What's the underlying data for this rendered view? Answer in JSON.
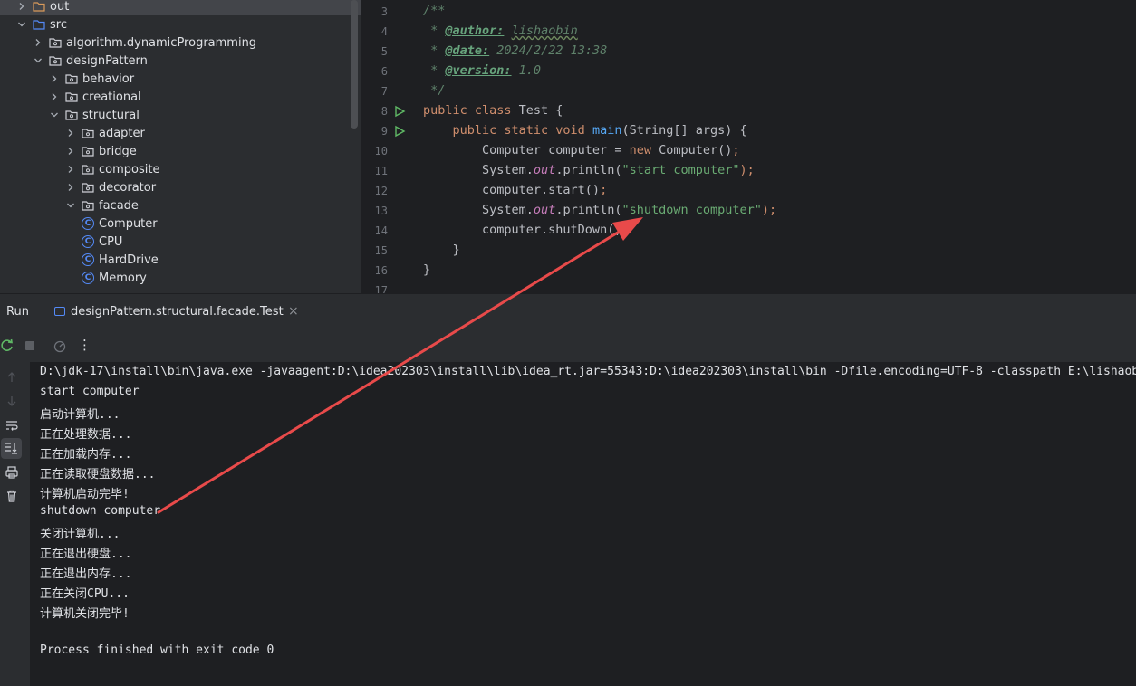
{
  "project_tree": [
    {
      "label": "out",
      "type": "folder",
      "state": "collapsed",
      "level": 0,
      "selected": true
    },
    {
      "label": "src",
      "type": "folder",
      "state": "expanded",
      "level": 0
    },
    {
      "label": "algorithm.dynamicProgramming",
      "type": "package",
      "state": "collapsed",
      "level": 1
    },
    {
      "label": "designPattern",
      "type": "package",
      "state": "expanded",
      "level": 1
    },
    {
      "label": "behavior",
      "type": "package",
      "state": "collapsed",
      "level": 2
    },
    {
      "label": "creational",
      "type": "package",
      "state": "collapsed",
      "level": 2
    },
    {
      "label": "structural",
      "type": "package",
      "state": "expanded",
      "level": 2
    },
    {
      "label": "adapter",
      "type": "package",
      "state": "collapsed",
      "level": 3
    },
    {
      "label": "bridge",
      "type": "package",
      "state": "collapsed",
      "level": 3
    },
    {
      "label": "composite",
      "type": "package",
      "state": "collapsed",
      "level": 3
    },
    {
      "label": "decorator",
      "type": "package",
      "state": "collapsed",
      "level": 3
    },
    {
      "label": "facade",
      "type": "package",
      "state": "expanded",
      "level": 3
    },
    {
      "label": "Computer",
      "type": "class",
      "level": 4
    },
    {
      "label": "CPU",
      "type": "class",
      "level": 4
    },
    {
      "label": "HardDrive",
      "type": "class",
      "level": 4
    },
    {
      "label": "Memory",
      "type": "class",
      "level": 4
    }
  ],
  "editor": {
    "line_numbers": [
      "3",
      "4",
      "5",
      "6",
      "7",
      "8",
      "9",
      "10",
      "11",
      "12",
      "13",
      "14",
      "15",
      "16",
      "17"
    ],
    "lines": {
      "l3": "/**",
      "l4_pre": " * ",
      "l4_tag": "@author:",
      "l4_val": "lishaobin",
      "l5_pre": " * ",
      "l5_tag": "@date:",
      "l5_val": " 2024/2/22 13:38",
      "l6_pre": " * ",
      "l6_tag": "@version:",
      "l6_val": " 1.0",
      "l7": " */",
      "l8_kw": "public class ",
      "l8_id": "Test {",
      "l9_kw": "    public static void ",
      "l9_fn": "main",
      "l9_id": "(String[] args) {",
      "l10_id1": "        Computer computer = ",
      "l10_kw": "new ",
      "l10_id2": "Computer()",
      "l10_end": ";",
      "l11_id1": "        System.",
      "l11_fld": "out",
      "l11_id2": ".println(",
      "l11_str": "\"start computer\"",
      "l11_end": ");",
      "l12_id": "        computer.start()",
      "l12_end": ";",
      "l13_id1": "        System.",
      "l13_fld": "out",
      "l13_id2": ".println(",
      "l13_str": "\"shutdown computer\"",
      "l13_end": ");",
      "l14_id": "        computer.shutDown();",
      "l15_id": "    }",
      "l16_id": "}"
    }
  },
  "run_panel": {
    "title": "Run",
    "tab_label": "designPattern.structural.facade.Test",
    "close_glyph": "×",
    "more_glyph": "⋮"
  },
  "console": {
    "lines": [
      "D:\\jdk-17\\install\\bin\\java.exe -javaagent:D:\\idea202303\\install\\lib\\idea_rt.jar=55343:D:\\idea202303\\install\\bin -Dfile.encoding=UTF-8 -classpath E:\\lishaobin\\",
      "start computer",
      "启动计算机...",
      "正在处理数据...",
      "正在加载内存...",
      "正在读取硬盘数据...",
      "计算机启动完毕!",
      "shutdown computer",
      "关闭计算机...",
      "正在退出硬盘...",
      "正在退出内存...",
      "正在关闭CPU...",
      "计算机关闭完毕!",
      "",
      "Process finished with exit code 0"
    ]
  },
  "colors": {
    "annotation_arrow": "#e84a4a",
    "run_gutter": "#5fb865",
    "class_icon": "#548af7"
  }
}
